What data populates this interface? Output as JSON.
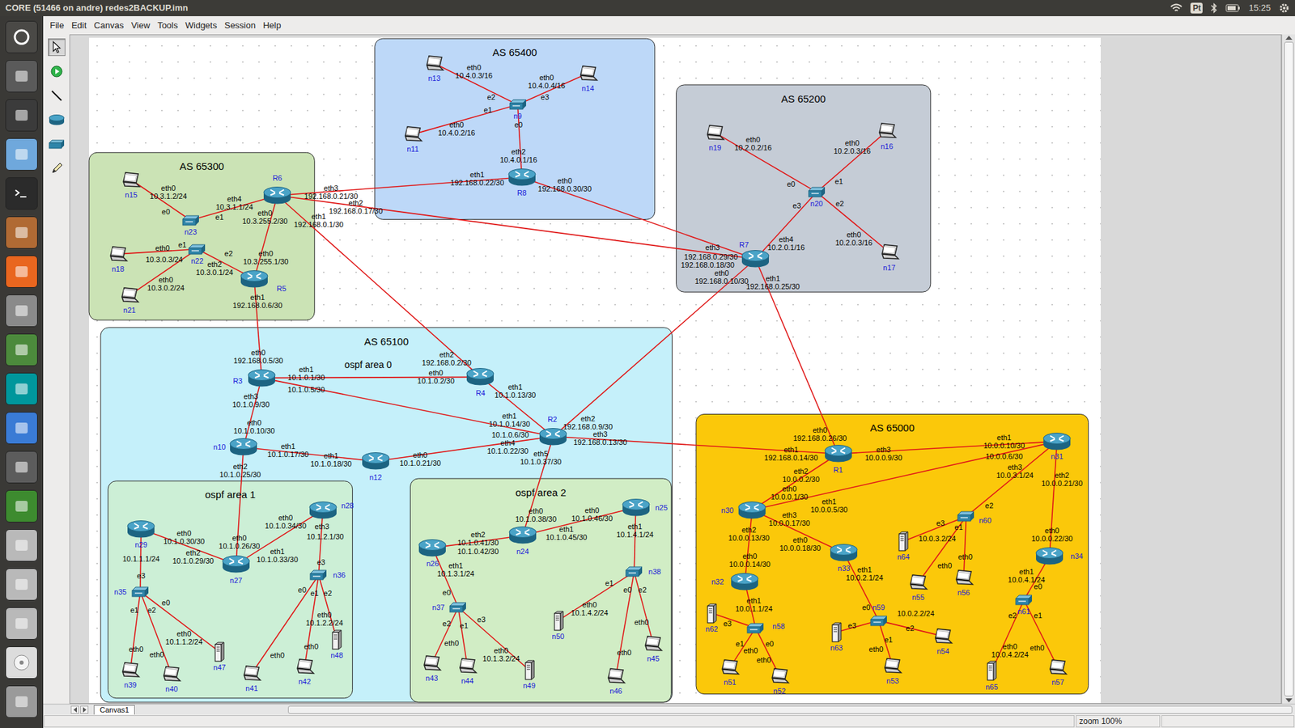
{
  "window": {
    "title": "CORE (51466 on andre) redes2BACKUP.imn"
  },
  "top_panel": {
    "input_method": "Pt",
    "time": "15:25"
  },
  "menu": [
    "File",
    "Edit",
    "Canvas",
    "View",
    "Tools",
    "Widgets",
    "Session",
    "Help"
  ],
  "toolbar": [
    {
      "selected": true
    },
    {
      "selected": false
    },
    {
      "selected": false
    },
    {
      "selected": false
    },
    {
      "selected": false
    },
    {
      "selected": false
    }
  ],
  "areas": [
    {
      "label": "AS 65400",
      "color": "#bdd8f8"
    },
    {
      "label": "AS 65200",
      "color": "#c5ccd6"
    },
    {
      "label": "AS 65300",
      "color": "#cbe3b5"
    },
    {
      "label": "AS 65100",
      "color": "#c5f0fa"
    },
    {
      "label": "ospf area 1",
      "color": "#ccefd6"
    },
    {
      "label": "ospf area 2",
      "color": "#d1edc5"
    },
    {
      "label": "AS 65000",
      "color": "#fbc80a"
    }
  ],
  "canvas_texts": [
    "ospf area 0"
  ],
  "nodes": [
    {
      "name": "n13",
      "kind": "pc"
    },
    {
      "name": "n14",
      "kind": "pc"
    },
    {
      "name": "n11",
      "kind": "pc"
    },
    {
      "name": "n9",
      "kind": "switch"
    },
    {
      "name": "R8",
      "kind": "router"
    },
    {
      "name": "n19",
      "kind": "pc"
    },
    {
      "name": "n16",
      "kind": "pc"
    },
    {
      "name": "n17",
      "kind": "pc"
    },
    {
      "name": "n20",
      "kind": "switch"
    },
    {
      "name": "R7",
      "kind": "router"
    },
    {
      "name": "n15",
      "kind": "pc"
    },
    {
      "name": "n23",
      "kind": "switch"
    },
    {
      "name": "R6",
      "kind": "router"
    },
    {
      "name": "n18",
      "kind": "pc"
    },
    {
      "name": "n22",
      "kind": "switch"
    },
    {
      "name": "n21",
      "kind": "pc"
    },
    {
      "name": "R5",
      "kind": "router"
    },
    {
      "name": "R3",
      "kind": "router"
    },
    {
      "name": "R4",
      "kind": "router"
    },
    {
      "name": "R2",
      "kind": "router"
    },
    {
      "name": "n10",
      "kind": "router"
    },
    {
      "name": "n12",
      "kind": "router"
    },
    {
      "name": "n29",
      "kind": "router"
    },
    {
      "name": "n27",
      "kind": "router"
    },
    {
      "name": "n28",
      "kind": "router"
    },
    {
      "name": "n35",
      "kind": "switch"
    },
    {
      "name": "n36",
      "kind": "switch"
    },
    {
      "name": "n39",
      "kind": "pc"
    },
    {
      "name": "n40",
      "kind": "pc"
    },
    {
      "name": "n47",
      "kind": "server"
    },
    {
      "name": "n41",
      "kind": "pc"
    },
    {
      "name": "n42",
      "kind": "pc"
    },
    {
      "name": "n48",
      "kind": "server"
    },
    {
      "name": "n24",
      "kind": "router"
    },
    {
      "name": "n26",
      "kind": "router"
    },
    {
      "name": "n25",
      "kind": "router"
    },
    {
      "name": "n37",
      "kind": "switch"
    },
    {
      "name": "n38",
      "kind": "switch"
    },
    {
      "name": "n43",
      "kind": "pc"
    },
    {
      "name": "n44",
      "kind": "pc"
    },
    {
      "name": "n49",
      "kind": "server"
    },
    {
      "name": "n50",
      "kind": "server"
    },
    {
      "name": "n46",
      "kind": "pc"
    },
    {
      "name": "n45",
      "kind": "pc"
    },
    {
      "name": "R1",
      "kind": "router"
    },
    {
      "name": "n31",
      "kind": "router"
    },
    {
      "name": "n30",
      "kind": "router"
    },
    {
      "name": "n33",
      "kind": "router"
    },
    {
      "name": "n32",
      "kind": "router"
    },
    {
      "name": "n34",
      "kind": "router"
    },
    {
      "name": "n60",
      "kind": "switch"
    },
    {
      "name": "n64",
      "kind": "server"
    },
    {
      "name": "n55",
      "kind": "pc"
    },
    {
      "name": "n56",
      "kind": "pc"
    },
    {
      "name": "n58",
      "kind": "switch"
    },
    {
      "name": "n62",
      "kind": "server"
    },
    {
      "name": "n51",
      "kind": "pc"
    },
    {
      "name": "n52",
      "kind": "pc"
    },
    {
      "name": "n59",
      "kind": "switch"
    },
    {
      "name": "n63",
      "kind": "server"
    },
    {
      "name": "n54",
      "kind": "pc"
    },
    {
      "name": "n53",
      "kind": "pc"
    },
    {
      "name": "n61",
      "kind": "switch"
    },
    {
      "name": "n65",
      "kind": "server"
    },
    {
      "name": "n57",
      "kind": "pc"
    }
  ],
  "links": [
    [
      0,
      3
    ],
    [
      1,
      3
    ],
    [
      2,
      3
    ],
    [
      3,
      4
    ],
    [
      4,
      12
    ],
    [
      4,
      9
    ],
    [
      12,
      9
    ],
    [
      12,
      11
    ],
    [
      12,
      16
    ],
    [
      12,
      18
    ],
    [
      10,
      11
    ],
    [
      13,
      14
    ],
    [
      15,
      14
    ],
    [
      14,
      16
    ],
    [
      5,
      8
    ],
    [
      6,
      8
    ],
    [
      7,
      8
    ],
    [
      8,
      9
    ],
    [
      9,
      19
    ],
    [
      9,
      44
    ],
    [
      16,
      17
    ],
    [
      17,
      18
    ],
    [
      17,
      19
    ],
    [
      17,
      20
    ],
    [
      18,
      19
    ],
    [
      19,
      21
    ],
    [
      19,
      44
    ],
    [
      19,
      33
    ],
    [
      20,
      21
    ],
    [
      20,
      23
    ],
    [
      23,
      22
    ],
    [
      23,
      24
    ],
    [
      22,
      25
    ],
    [
      25,
      27
    ],
    [
      25,
      28
    ],
    [
      25,
      29
    ],
    [
      24,
      26
    ],
    [
      26,
      30
    ],
    [
      26,
      31
    ],
    [
      26,
      32
    ],
    [
      33,
      34
    ],
    [
      33,
      35
    ],
    [
      34,
      36
    ],
    [
      36,
      38
    ],
    [
      36,
      39
    ],
    [
      36,
      40
    ],
    [
      35,
      37
    ],
    [
      37,
      41
    ],
    [
      37,
      42
    ],
    [
      37,
      43
    ],
    [
      44,
      45
    ],
    [
      44,
      46
    ],
    [
      45,
      46
    ],
    [
      45,
      50
    ],
    [
      45,
      49
    ],
    [
      46,
      47
    ],
    [
      46,
      48
    ],
    [
      48,
      54
    ],
    [
      47,
      58
    ],
    [
      54,
      55
    ],
    [
      54,
      56
    ],
    [
      54,
      57
    ],
    [
      58,
      59
    ],
    [
      58,
      60
    ],
    [
      58,
      61
    ],
    [
      50,
      51
    ],
    [
      50,
      52
    ],
    [
      50,
      53
    ],
    [
      49,
      62
    ],
    [
      62,
      63
    ],
    [
      62,
      64
    ]
  ],
  "iface_labels": [
    {
      "lines": [
        "eth0",
        "10.4.0.3/16"
      ]
    },
    {
      "lines": [
        "eth0",
        "10.4.0.4/16"
      ]
    },
    {
      "lines": [
        "e2"
      ]
    },
    {
      "lines": [
        "e3"
      ]
    },
    {
      "lines": [
        "e1"
      ]
    },
    {
      "lines": [
        "e0"
      ]
    },
    {
      "lines": [
        "eth0",
        "10.4.0.2/16"
      ]
    },
    {
      "lines": [
        "eth2",
        "10.4.0.1/16"
      ]
    },
    {
      "lines": [
        "eth1",
        "192.168.0.22/30"
      ]
    },
    {
      "lines": [
        "eth0",
        "192.168.0.30/30"
      ]
    },
    {
      "lines": [
        "eth0",
        "10.2.0.2/16"
      ]
    },
    {
      "lines": [
        "eth0",
        "10.2.0.3/16"
      ]
    },
    {
      "lines": [
        "e0"
      ]
    },
    {
      "lines": [
        "e1"
      ]
    },
    {
      "lines": [
        "e3"
      ]
    },
    {
      "lines": [
        "e2"
      ]
    },
    {
      "lines": [
        "eth0",
        "10.2.0.3/16"
      ]
    },
    {
      "lines": [
        "eth4",
        "10.2.0.1/16"
      ]
    },
    {
      "lines": [
        "eth3"
      ]
    },
    {
      "lines": [
        "192.168.0.29/30"
      ]
    },
    {
      "lines": [
        "192.168.0.18/30"
      ]
    },
    {
      "lines": [
        "eth0",
        "192.168.0.10/30"
      ]
    },
    {
      "lines": [
        "eth1",
        "192.168.0.25/30"
      ]
    },
    {
      "lines": [
        "eth0",
        "10.3.1.2/24"
      ]
    },
    {
      "lines": [
        "eth4",
        "10.3.1.1/24"
      ]
    },
    {
      "lines": [
        "e0"
      ]
    },
    {
      "lines": [
        "e1"
      ]
    },
    {
      "lines": [
        "eth3",
        "192.168.0.21/30"
      ]
    },
    {
      "lines": [
        "eth2",
        "192.168.0.17/30"
      ]
    },
    {
      "lines": [
        "eth1",
        "192.168.0.1/30"
      ]
    },
    {
      "lines": [
        "eth0",
        "10.3.255.2/30"
      ]
    },
    {
      "lines": [
        "eth0"
      ]
    },
    {
      "lines": [
        "e1"
      ]
    },
    {
      "lines": [
        "10.3.0.3/24"
      ]
    },
    {
      "lines": [
        "e2"
      ]
    },
    {
      "lines": [
        "eth2",
        "10.3.0.1/24"
      ]
    },
    {
      "lines": [
        "eth0",
        "10.3.255.1/30"
      ]
    },
    {
      "lines": [
        "eth0",
        "10.3.0.2/24"
      ]
    },
    {
      "lines": [
        "eth1",
        "192.168.0.6/30"
      ]
    },
    {
      "lines": [
        "eth0",
        "192.168.0.5/30"
      ]
    },
    {
      "lines": [
        "eth2",
        "192.168.0.2/30"
      ]
    },
    {
      "lines": [
        "eth0",
        "10.1.0.2/30"
      ]
    },
    {
      "lines": [
        "eth1",
        "10.1.0.1/30"
      ]
    },
    {
      "lines": [
        "10.1.0.5/30"
      ]
    },
    {
      "lines": [
        "eth1",
        "10.1.0.13/30"
      ]
    },
    {
      "lines": [
        "eth3",
        "10.1.0.9/30"
      ]
    },
    {
      "lines": [
        "eth0",
        "10.1.0.10/30"
      ]
    },
    {
      "lines": [
        "eth1",
        "10.1.0.14/30"
      ]
    },
    {
      "lines": [
        "10.1.0.6/30"
      ]
    },
    {
      "lines": [
        "eth4",
        "10.1.0.22/30"
      ]
    },
    {
      "lines": [
        "eth2",
        "192.168.0.9/30"
      ]
    },
    {
      "lines": [
        "eth3",
        "192.168.0.13/30"
      ]
    },
    {
      "lines": [
        "eth5",
        "10.1.0.37/30"
      ]
    },
    {
      "lines": [
        "eth1",
        "10.1.0.17/30"
      ]
    },
    {
      "lines": [
        "eth2",
        "10.1.0.25/30"
      ]
    },
    {
      "lines": [
        "eth1",
        "10.1.0.18/30"
      ]
    },
    {
      "lines": [
        "eth0",
        "10.1.0.21/30"
      ]
    },
    {
      "lines": [
        "eth0",
        "10.1.0.34/30"
      ]
    },
    {
      "lines": [
        "eth3"
      ]
    },
    {
      "lines": [
        "10.1.2.1/30"
      ]
    },
    {
      "lines": [
        "eth0",
        "10.1.0.30/30"
      ]
    },
    {
      "lines": [
        "eth0",
        "10.1.0.26/30"
      ]
    },
    {
      "lines": [
        "eth1",
        "10.1.0.33/30"
      ]
    },
    {
      "lines": [
        "eth2",
        "10.1.0.29/30"
      ]
    },
    {
      "lines": [
        "10.1.1.1/24"
      ]
    },
    {
      "lines": [
        "e3"
      ]
    },
    {
      "lines": [
        "e1"
      ]
    },
    {
      "lines": [
        "e2"
      ]
    },
    {
      "lines": [
        "e0"
      ]
    },
    {
      "lines": [
        "e3"
      ]
    },
    {
      "lines": [
        "e0"
      ]
    },
    {
      "lines": [
        "e1"
      ]
    },
    {
      "lines": [
        "e2"
      ]
    },
    {
      "lines": [
        "eth0",
        "10.1.1.2/24"
      ]
    },
    {
      "lines": [
        "eth0",
        "10.1.2.2/24"
      ]
    },
    {
      "lines": [
        "eth0"
      ]
    },
    {
      "lines": [
        "eth0"
      ]
    },
    {
      "lines": [
        "eth0"
      ]
    },
    {
      "lines": [
        "eth0"
      ]
    },
    {
      "lines": [
        "eth0",
        "10.1.0.38/30"
      ]
    },
    {
      "lines": [
        "eth0",
        "10.1.0.46/30"
      ]
    },
    {
      "lines": [
        "eth1",
        "10.1.0.45/30"
      ]
    },
    {
      "lines": [
        "eth2",
        "10.1.0.41/30"
      ]
    },
    {
      "lines": [
        "10.1.0.42/30"
      ]
    },
    {
      "lines": [
        "eth1",
        "10.1.3.1/24"
      ]
    },
    {
      "lines": [
        "eth1",
        "10.1.4.1/24"
      ]
    },
    {
      "lines": [
        "e0"
      ]
    },
    {
      "lines": [
        "e2"
      ]
    },
    {
      "lines": [
        "e1"
      ]
    },
    {
      "lines": [
        "e3"
      ]
    },
    {
      "lines": [
        "e1"
      ]
    },
    {
      "lines": [
        "e0"
      ]
    },
    {
      "lines": [
        "e2"
      ]
    },
    {
      "lines": [
        "eth0",
        "10.1.4.2/24"
      ]
    },
    {
      "lines": [
        "eth0",
        "10.1.3.2/24"
      ]
    },
    {
      "lines": [
        "eth0"
      ]
    },
    {
      "lines": [
        "eth0"
      ]
    },
    {
      "lines": [
        "eth0"
      ]
    },
    {
      "lines": [
        "eth0",
        "192.168.0.26/30"
      ]
    },
    {
      "lines": [
        "eth1",
        "192.168.0.14/30"
      ]
    },
    {
      "lines": [
        "eth3",
        "10.0.0.9/30"
      ]
    },
    {
      "lines": [
        "eth2",
        "10.0.0.2/30"
      ]
    },
    {
      "lines": [
        "eth1",
        "10.0.0.10/30"
      ]
    },
    {
      "lines": [
        "10.0.0.6/30"
      ]
    },
    {
      "lines": [
        "eth3",
        "10.0.3.1/24"
      ]
    },
    {
      "lines": [
        "eth2",
        "10.0.0.21/30"
      ]
    },
    {
      "lines": [
        "eth0",
        "10.0.0.1/30"
      ]
    },
    {
      "lines": [
        "eth1",
        "10.0.0.5/30"
      ]
    },
    {
      "lines": [
        "eth3",
        "10.0.0.17/30"
      ]
    },
    {
      "lines": [
        "eth2",
        "10.0.0.13/30"
      ]
    },
    {
      "lines": [
        "eth0",
        "10.0.0.18/30"
      ]
    },
    {
      "lines": [
        "e3"
      ]
    },
    {
      "lines": [
        "e2"
      ]
    },
    {
      "lines": [
        "e1"
      ]
    },
    {
      "lines": [
        "10.0.3.2/24"
      ]
    },
    {
      "lines": [
        "eth0"
      ]
    },
    {
      "lines": [
        "eth0"
      ]
    },
    {
      "lines": [
        "eth0",
        "10.0.0.22/30"
      ]
    },
    {
      "lines": [
        "eth1",
        "10.0.2.1/24"
      ]
    },
    {
      "lines": [
        "eth0",
        "10.0.0.14/30"
      ]
    },
    {
      "lines": [
        "eth1",
        "10.0.4.1/24"
      ]
    },
    {
      "lines": [
        "e0"
      ]
    },
    {
      "lines": [
        "e2"
      ]
    },
    {
      "lines": [
        "e1"
      ]
    },
    {
      "lines": [
        "eth1",
        "10.0.1.1/24"
      ]
    },
    {
      "lines": [
        "e3"
      ]
    },
    {
      "lines": [
        "e1"
      ]
    },
    {
      "lines": [
        "e0"
      ]
    },
    {
      "lines": [
        "eth0"
      ]
    },
    {
      "lines": [
        "eth0"
      ]
    },
    {
      "lines": [
        "e0"
      ]
    },
    {
      "lines": [
        "e3"
      ]
    },
    {
      "lines": [
        "10.0.2.2/24"
      ]
    },
    {
      "lines": [
        "e2"
      ]
    },
    {
      "lines": [
        "e1"
      ]
    },
    {
      "lines": [
        "eth0"
      ]
    },
    {
      "lines": [
        "eth0",
        "10.0.4.2/24"
      ]
    },
    {
      "lines": [
        "eth0"
      ]
    }
  ],
  "tabs": [
    {
      "label": "Canvas1",
      "selected": true
    }
  ],
  "status_bar": {
    "zoom": "zoom 100%"
  }
}
